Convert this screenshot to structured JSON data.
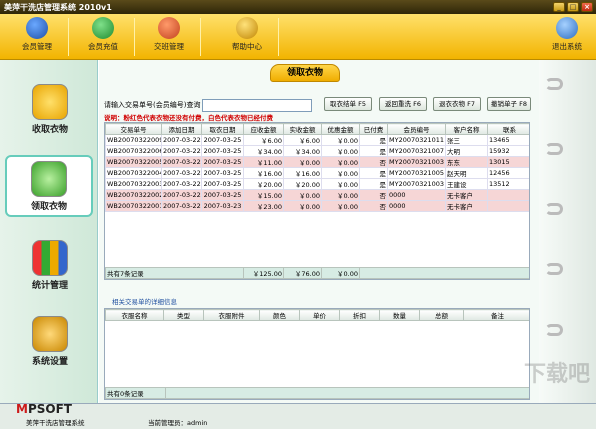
{
  "window": {
    "title": "美萍干洗店管理系统 2010v1"
  },
  "toolbar": {
    "items": [
      {
        "label": "会员管理"
      },
      {
        "label": "会员充值"
      },
      {
        "label": "交班管理"
      },
      {
        "label": "帮助中心"
      }
    ],
    "exit_label": "退出系统"
  },
  "sidebar": {
    "items": [
      {
        "label": "收取衣物"
      },
      {
        "label": "领取衣物"
      },
      {
        "label": "统计管理"
      },
      {
        "label": "系统设置"
      }
    ]
  },
  "page": {
    "title": "领取衣物"
  },
  "search": {
    "label": "请输入交易单号(会员编号)查询",
    "value": ""
  },
  "actions": {
    "receive": "取衣结单 F5",
    "rewash": "返回重洗 F6",
    "refund": "退衣衣物 F7",
    "cancel": "撤销单子 F8"
  },
  "hint": "说明：粉红色代表衣物还没有付费，白色代表衣物已经付费",
  "orders": {
    "columns": [
      "交易单号",
      "添加日期",
      "取衣日期",
      "应收金额",
      "实收金额",
      "优惠金额",
      "已付费",
      "会员编号",
      "客户名称",
      "联系"
    ],
    "rows": [
      {
        "id": "WB20070322009",
        "add": "2007-03-22",
        "take": "2007-03-25",
        "due": "￥6.00",
        "paid": "￥6.00",
        "disc": "￥0.00",
        "payed": "是",
        "member": "MY20070321011",
        "name": "张三",
        "phone": "13465",
        "pink": false
      },
      {
        "id": "WB20070322006",
        "add": "2007-03-22",
        "take": "2007-03-25",
        "due": "￥34.00",
        "paid": "￥34.00",
        "disc": "￥0.00",
        "payed": "是",
        "member": "MY20070321007",
        "name": "大明",
        "phone": "15932",
        "pink": false
      },
      {
        "id": "WB20070322005",
        "add": "2007-03-22",
        "take": "2007-03-25",
        "due": "￥11.00",
        "paid": "￥0.00",
        "disc": "￥0.00",
        "payed": "否",
        "member": "MY20070321003",
        "name": "东东",
        "phone": "13015",
        "pink": true
      },
      {
        "id": "WB20070322004",
        "add": "2007-03-22",
        "take": "2007-03-25",
        "due": "￥16.00",
        "paid": "￥16.00",
        "disc": "￥0.00",
        "payed": "是",
        "member": "MY20070321005",
        "name": "赵天明",
        "phone": "12456",
        "pink": false
      },
      {
        "id": "WB20070322003",
        "add": "2007-03-22",
        "take": "2007-03-25",
        "due": "￥20.00",
        "paid": "￥20.00",
        "disc": "￥0.00",
        "payed": "是",
        "member": "MY20070321003",
        "name": "王建设",
        "phone": "13512",
        "pink": false
      },
      {
        "id": "WB20070322002",
        "add": "2007-03-22",
        "take": "2007-03-25",
        "due": "￥15.00",
        "paid": "￥0.00",
        "disc": "￥0.00",
        "payed": "否",
        "member": "0000",
        "name": "无卡客户",
        "phone": "",
        "pink": true
      },
      {
        "id": "WB20070322001",
        "add": "2007-03-22",
        "take": "2007-03-23",
        "due": "￥23.00",
        "paid": "￥0.00",
        "disc": "￥0.00",
        "payed": "否",
        "member": "0000",
        "name": "无卡客户",
        "phone": "",
        "pink": true
      }
    ],
    "footer": {
      "count": "共有7条记录",
      "due": "￥125.00",
      "paid": "￥76.00",
      "disc": "￥0.00"
    }
  },
  "detail": {
    "title": "相关交易单的详细信息",
    "columns": [
      "衣服名称",
      "类型",
      "衣服附件",
      "颜色",
      "单价",
      "折扣",
      "数量",
      "总额",
      "备注"
    ],
    "footer": {
      "count": "共有0条记录"
    }
  },
  "status": {
    "logo_m": "M",
    "logo_rest": "PSOFT",
    "app": "美萍干洗店管理系统",
    "admin": "当前管理员：admin",
    "watermark": "下载吧"
  },
  "colors": {
    "toolbar": "#f2b400",
    "pink_row": "#f6d6d6",
    "hint": "#d00000"
  }
}
